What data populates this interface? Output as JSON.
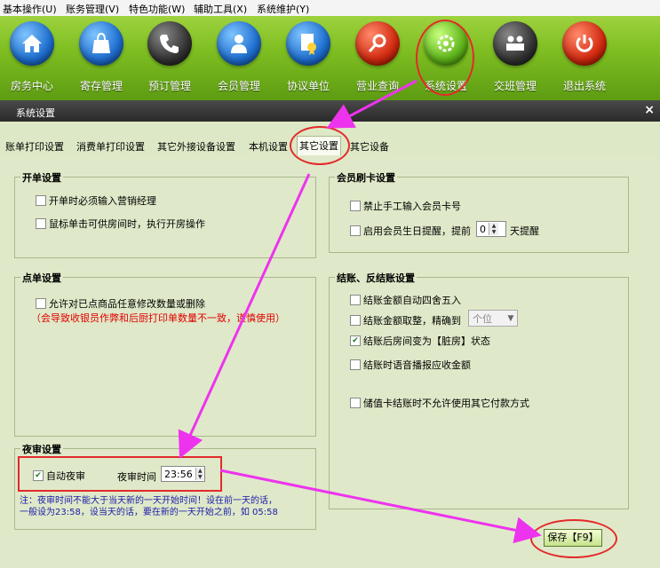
{
  "menubar": [
    "基本操作(U)",
    "账务管理(V)",
    "特色功能(W)",
    "辅助工具(X)",
    "系统维护(Y)"
  ],
  "toolbar": [
    {
      "label": "房务中心",
      "icon": "home-icon"
    },
    {
      "label": "寄存管理",
      "icon": "bag-icon"
    },
    {
      "label": "预订管理",
      "icon": "phone-icon"
    },
    {
      "label": "会员管理",
      "icon": "user-icon"
    },
    {
      "label": "协议单位",
      "icon": "certificate-icon"
    },
    {
      "label": "营业查询",
      "icon": "magnifier-icon"
    },
    {
      "label": "系统设置",
      "icon": "gear-icon"
    },
    {
      "label": "交班管理",
      "icon": "team-icon"
    },
    {
      "label": "退出系统",
      "icon": "power-icon"
    }
  ],
  "dialog": {
    "title": "系统设置",
    "close": "×"
  },
  "tabs": [
    "账单打印设置",
    "消费单打印设置",
    "其它外接设备设置",
    "本机设置",
    "其它设置",
    "其它设备"
  ],
  "active_tab": "其它设置",
  "open_settings": {
    "title": "开单设置",
    "items": [
      {
        "label": "开单时必须输入营销经理",
        "checked": false
      },
      {
        "label": "鼠标单击可供房间时，执行开房操作",
        "checked": false
      }
    ]
  },
  "order_settings": {
    "title": "点单设置",
    "item": {
      "label": "允许对已点商品任意修改数量或删除",
      "checked": false
    },
    "warning": "（会导致收银员作弊和后厨打印单数量不一致，谨慎使用）"
  },
  "night_audit": {
    "title": "夜审设置",
    "auto": {
      "label": "自动夜审",
      "checked": true
    },
    "time_label": "夜审时间",
    "time_value": "23:56",
    "note_line1": "注：夜审时间不能大于当天新的一天开始时间！设在前一天的话，",
    "note_line2": "一般设为23:58，设当天的话，要在新的一天开始之前，如 05:58"
  },
  "member_card": {
    "title": "会员刷卡设置",
    "items": [
      {
        "label": "禁止手工输入会员卡号",
        "checked": false
      }
    ],
    "birthday_label": "启用会员生日提醒，提前",
    "birthday_checked": false,
    "birthday_value": "0",
    "birthday_suffix": "天提醒"
  },
  "checkout": {
    "title": "结账、反结账设置",
    "round_label": "结账金额自动四舍五入",
    "round_checked": false,
    "precise_label": "结账金额取整，精确到",
    "precise_checked": false,
    "precise_select": "个位",
    "dirty_label": "结账后房间变为【脏房】状态",
    "dirty_checked": true,
    "voice_label": "结账时语音播报应收金额",
    "voice_checked": false,
    "stored_card_label": "储值卡结账时不允许使用其它付款方式",
    "stored_card_checked": false
  },
  "save_button": "保存【F9】",
  "colors": {
    "toolbar_green": "#7fbf22",
    "panel_bg": "#dfe9c9",
    "annotation": "#e32a2a",
    "arrow": "#ee33ee"
  }
}
